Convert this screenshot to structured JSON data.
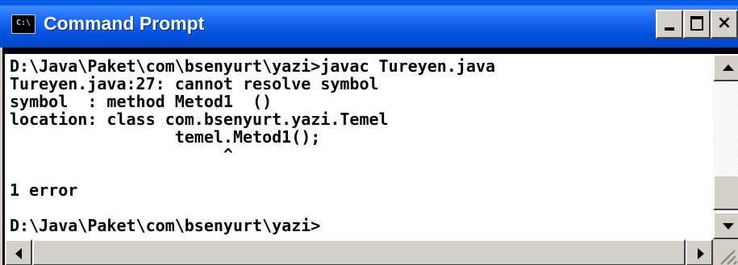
{
  "window": {
    "title": "Command Prompt",
    "icon": "console-icon",
    "icon_glyph": "C:\\"
  },
  "controls": {
    "minimize_icon": "minimize-icon",
    "maximize_icon": "maximize-icon",
    "close_icon": "close-icon",
    "close_glyph": "×"
  },
  "console": {
    "background": "#ffffff",
    "foreground": "#000000",
    "lines": [
      "D:\\Java\\Paket\\com\\bsenyurt\\yazi>javac Tureyen.java",
      "Tureyen.java:27: cannot resolve symbol",
      "symbol  : method Metod1  ()",
      "location: class com.bsenyurt.yazi.Temel",
      "                 temel.Metod1();",
      "                      ^",
      "",
      "1 error",
      "",
      "D:\\Java\\Paket\\com\\bsenyurt\\yazi>"
    ]
  },
  "colors": {
    "titlebar": "#0058e6",
    "title_text": "#ffffff",
    "chrome": "#d4d0c8"
  }
}
